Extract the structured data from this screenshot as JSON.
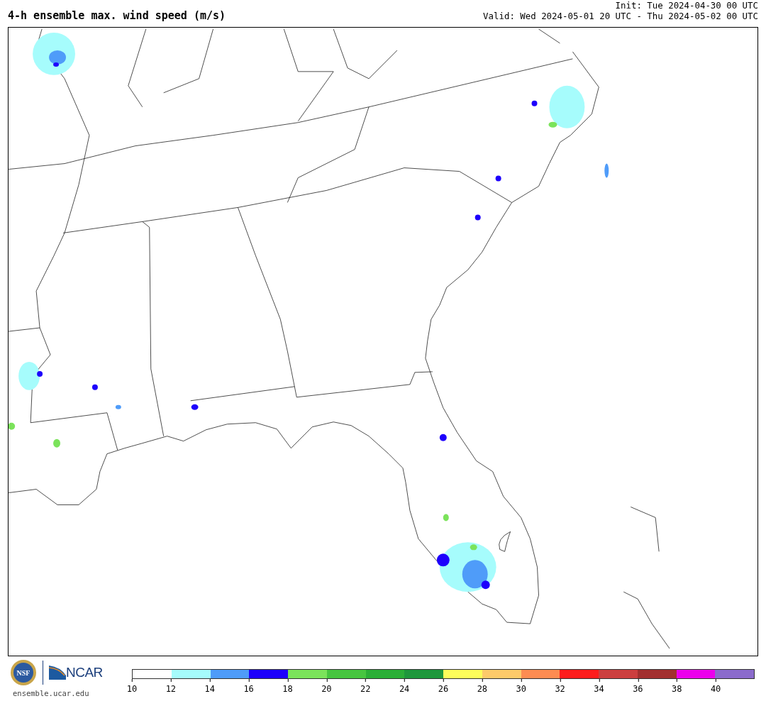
{
  "title": "4-h ensemble max. wind speed (m/s)",
  "init": "Init: Tue 2024-04-30 00 UTC",
  "valid": "Valid: Wed 2024-05-01 20 UTC - Thu 2024-05-02 00 UTC",
  "logos": {
    "nsf": "NSF",
    "ncar": "NCAR",
    "site": "ensemble.ucar.edu"
  },
  "colorbar": {
    "segments": [
      {
        "color": "#ffffff"
      },
      {
        "color": "#a6fcfc"
      },
      {
        "color": "#4f9cf9"
      },
      {
        "color": "#1d00fc"
      },
      {
        "color": "#7be35b"
      },
      {
        "color": "#47c540"
      },
      {
        "color": "#2bae37"
      },
      {
        "color": "#1f973c"
      },
      {
        "color": "#fdfd5b"
      },
      {
        "color": "#fdca6a"
      },
      {
        "color": "#fd8c52"
      },
      {
        "color": "#fd1c1c"
      },
      {
        "color": "#cc3f3f"
      },
      {
        "color": "#a23030"
      },
      {
        "color": "#ec00ec"
      },
      {
        "color": "#8b6bcc"
      }
    ],
    "ticks": [
      "10",
      "12",
      "14",
      "16",
      "18",
      "20",
      "22",
      "24",
      "26",
      "28",
      "30",
      "32",
      "34",
      "36",
      "38",
      "40"
    ]
  }
}
